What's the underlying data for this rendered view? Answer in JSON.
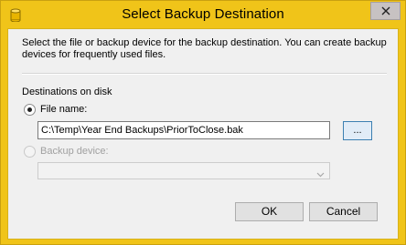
{
  "window": {
    "title": "Select Backup Destination",
    "accent_color": "#f0c419",
    "app_icon": "database-cylinder-icon",
    "close_icon": "close-icon"
  },
  "content": {
    "description": "Select the file or backup device for the backup destination. You can create backup devices for frequently used files.",
    "group_label": "Destinations on disk",
    "file_option": {
      "label": "File name:",
      "selected": true,
      "value": "C:\\Temp\\Year End Backups\\PriorToClose.bak",
      "browse_label": "..."
    },
    "device_option": {
      "label": "Backup device:",
      "selected": false,
      "enabled": false,
      "value": ""
    }
  },
  "buttons": {
    "ok_label": "OK",
    "cancel_label": "Cancel"
  }
}
